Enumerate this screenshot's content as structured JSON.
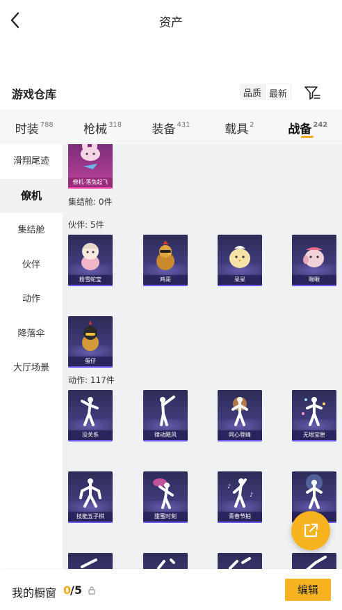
{
  "header": {
    "title": "资产"
  },
  "warehouse": {
    "title": "游戏仓库",
    "sort": [
      "品质",
      "最新"
    ],
    "active_sort": 1
  },
  "tabs": [
    {
      "label": "时装",
      "count": "788"
    },
    {
      "label": "枪械",
      "count": "318"
    },
    {
      "label": "装备",
      "count": "431"
    },
    {
      "label": "载具",
      "count": "2"
    },
    {
      "label": "战备",
      "count": "242"
    }
  ],
  "active_tab": 4,
  "sidebar": {
    "items": [
      "滑翔尾迹",
      "僚机",
      "集结舱",
      "伙伴",
      "动作",
      "降落伞",
      "大厅场景"
    ],
    "active": 1
  },
  "sections": {
    "wingman_item": {
      "name": "僚机-落兔起飞"
    },
    "capsule": {
      "label": "集结舱: 0件"
    },
    "partner": {
      "label": "伙伴: 5件",
      "items": [
        "粉雪蛇宝",
        "鸡哥",
        "呆呆",
        "啾啾",
        "蛋仔"
      ]
    },
    "emote": {
      "label": "动作: 117件",
      "items": [
        "没关系",
        "律动飓风",
        "同心登峰",
        "无垠宝匣",
        "技能五子棋",
        "甜蜜时刻",
        "青春节拍",
        ""
      ]
    }
  },
  "bottom": {
    "window_label": "我的橱窗",
    "used": "0",
    "sep": "/",
    "max": "5",
    "edit_label": "编辑"
  },
  "colors": {
    "accent": "#f7b21f",
    "card_bg": "#2d2c57",
    "content_bg": "#f0f1f3"
  },
  "icons": {
    "back": "chevron-left-icon",
    "filter": "filter-icon",
    "share": "share-external-icon",
    "lock": "lock-icon"
  }
}
